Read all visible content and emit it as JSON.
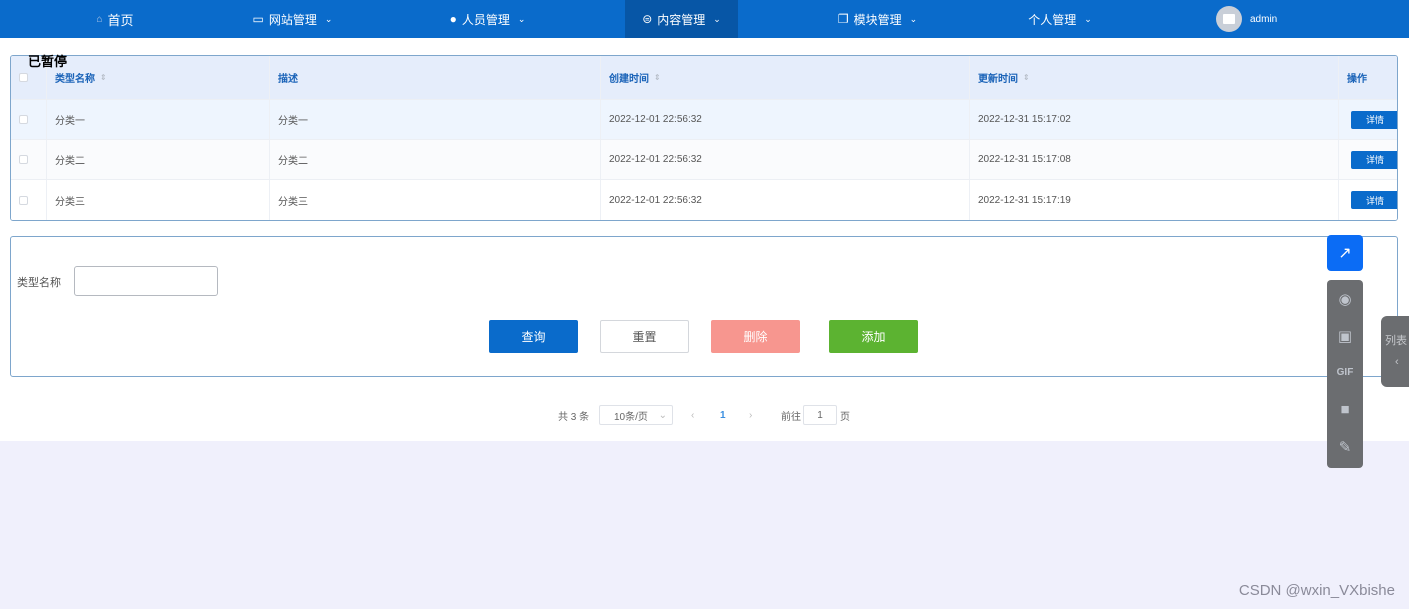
{
  "nav": {
    "items": [
      {
        "label": "首页",
        "icon": "home-icon"
      },
      {
        "label": "网站管理",
        "icon": "monitor-icon"
      },
      {
        "label": "人员管理",
        "icon": "user-icon"
      },
      {
        "label": "内容管理",
        "icon": "chat-icon",
        "active": true
      },
      {
        "label": "模块管理",
        "icon": "copy-icon"
      },
      {
        "label": "个人管理"
      }
    ],
    "user": "admin"
  },
  "overlay": {
    "paused": "已暂停"
  },
  "table": {
    "headers": [
      "类型名称",
      "描述",
      "创建时间",
      "更新时间",
      "操作"
    ],
    "rows": [
      {
        "name": "分类一",
        "desc": "分类一",
        "created": "2022-12-01 22:56:32",
        "updated": "2022-12-31 15:17:02",
        "action": "详情"
      },
      {
        "name": "分类二",
        "desc": "分类二",
        "created": "2022-12-01 22:56:32",
        "updated": "2022-12-31 15:17:08",
        "action": "详情"
      },
      {
        "name": "分类三",
        "desc": "分类三",
        "created": "2022-12-01 22:56:32",
        "updated": "2022-12-31 15:17:19",
        "action": "详情"
      }
    ]
  },
  "form": {
    "label": "类型名称",
    "value": "",
    "buttons": {
      "query": "查询",
      "reset": "重置",
      "delete": "删除",
      "add": "添加"
    }
  },
  "pagination": {
    "total": "共 3 条",
    "page_size": "10条/页",
    "current": "1",
    "goto_prefix": "前往",
    "goto_value": "1",
    "goto_suffix": "页"
  },
  "side": {
    "list_tab": "列表"
  },
  "watermark": "CSDN @wxin_VXbishe"
}
